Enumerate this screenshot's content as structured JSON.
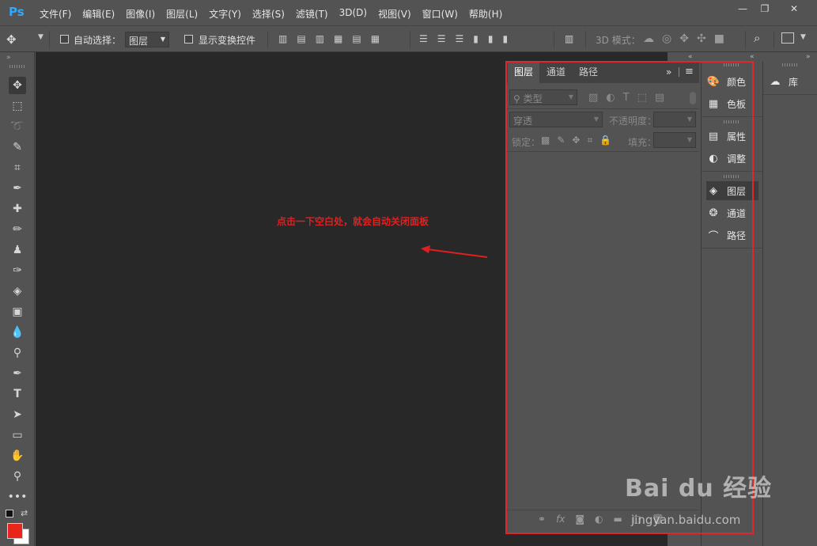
{
  "app": {
    "logo": "Ps"
  },
  "menu": [
    "文件(F)",
    "编辑(E)",
    "图像(I)",
    "图层(L)",
    "文字(Y)",
    "选择(S)",
    "滤镜(T)",
    "3D(D)",
    "视图(V)",
    "窗口(W)",
    "帮助(H)"
  ],
  "window_controls": {
    "minimize": "—",
    "restore": "❐",
    "close": "✕"
  },
  "options": {
    "auto_select_label": "自动选择：",
    "auto_select_value": "图层",
    "show_transform_label": "显示变换控件",
    "mode_3d_label": "3D 模式："
  },
  "canvas": {
    "annotation": "点击一下空白处，就会自动关闭面板"
  },
  "layers_panel": {
    "tabs": [
      "图层",
      "通道",
      "路径"
    ],
    "filter_label": "类型",
    "blend_mode": "穿透",
    "opacity_label": "不透明度：",
    "lock_label": "锁定：",
    "fill_label": "填充："
  },
  "dock": {
    "items": [
      "颜色",
      "色板",
      "属性",
      "调整",
      "图层",
      "通道",
      "路径"
    ]
  },
  "library": {
    "label": "库"
  },
  "watermark": {
    "brand": "Bai du 经验",
    "url": "jingyan.baidu.com"
  },
  "colors": {
    "accent": "#31a8ff",
    "annotation": "#e02020",
    "highlight_box": "#e0252b",
    "foreground": "#e8261c"
  }
}
